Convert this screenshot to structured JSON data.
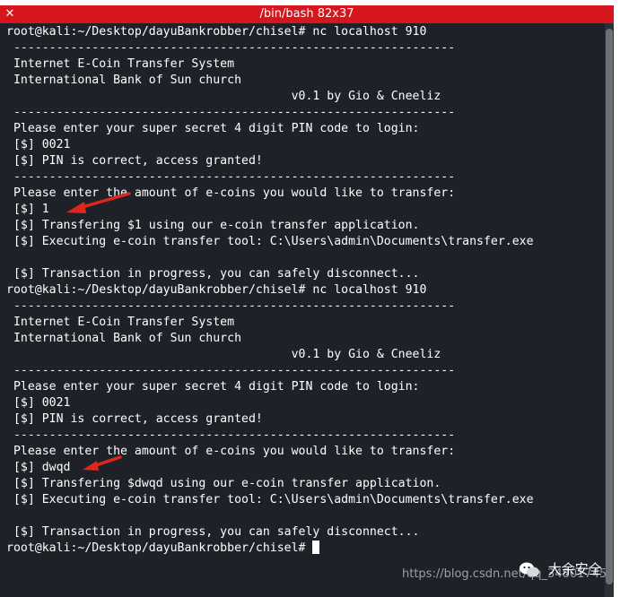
{
  "window": {
    "title": "/bin/bash 82x37",
    "close_glyph": "✕"
  },
  "terminal": {
    "lines": [
      "root@kali:~/Desktop/dayuBankrobber/chisel# nc localhost 910",
      " --------------------------------------------------------------",
      " Internet E-Coin Transfer System",
      " International Bank of Sun church",
      "                                        v0.1 by Gio & Cneeliz",
      " --------------------------------------------------------------",
      " Please enter your super secret 4 digit PIN code to login:",
      " [$] 0021",
      " [$] PIN is correct, access granted!",
      " --------------------------------------------------------------",
      " Please enter the amount of e-coins you would like to transfer:",
      " [$] 1",
      " [$] Transfering $1 using our e-coin transfer application.",
      " [$] Executing e-coin transfer tool: C:\\Users\\admin\\Documents\\transfer.exe",
      "",
      " [$] Transaction in progress, you can safely disconnect...",
      "root@kali:~/Desktop/dayuBankrobber/chisel# nc localhost 910",
      " --------------------------------------------------------------",
      " Internet E-Coin Transfer System",
      " International Bank of Sun church",
      "                                        v0.1 by Gio & Cneeliz",
      " --------------------------------------------------------------",
      " Please enter your super secret 4 digit PIN code to login:",
      " [$] 0021",
      " [$] PIN is correct, access granted!",
      " --------------------------------------------------------------",
      " Please enter the amount of e-coins you would like to transfer:",
      " [$] dwqd",
      " [$] Transfering $dwqd using our e-coin transfer application.",
      " [$] Executing e-coin transfer tool: C:\\Users\\admin\\Documents\\transfer.exe",
      "",
      " [$] Transaction in progress, you can safely disconnect...",
      "root@kali:~/Desktop/dayuBankrobber/chisel#"
    ]
  },
  "watermark": {
    "url": "https://blog.csdn.net/qq_34801745",
    "brand": "大余安全"
  },
  "colors": {
    "titlebar": "#d5161c",
    "terminal_bg": "#1e2128",
    "terminal_fg": "#ffffff",
    "annotation_arrow": "#e0251f"
  },
  "icons": {
    "annotation": "red-arrow-icon",
    "wechat": "wechat-icon"
  }
}
